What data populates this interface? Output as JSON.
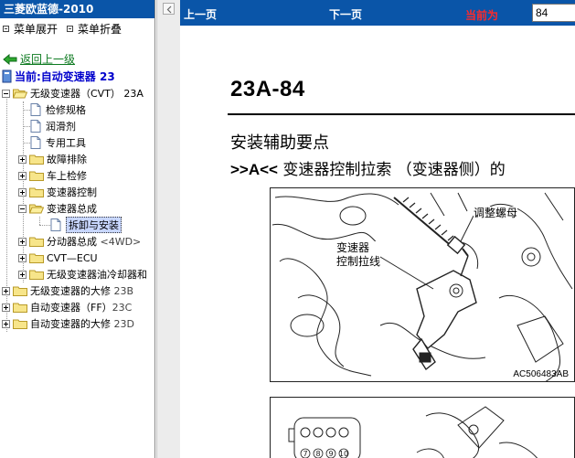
{
  "app": {
    "title": "三菱欧蓝德-2010"
  },
  "menu": {
    "expand": "菜单展开",
    "collapse": "菜单折叠"
  },
  "back": {
    "label": "返回上一级"
  },
  "current": {
    "label": "当前:自动变速器  23"
  },
  "tree": [
    {
      "label": "无级变速器（CVT） 23A",
      "sub": ""
    },
    {
      "label": "检修规格",
      "sub": ""
    },
    {
      "label": "润滑剂",
      "sub": ""
    },
    {
      "label": "专用工具",
      "sub": ""
    },
    {
      "label": "故障排除",
      "sub": ""
    },
    {
      "label": "车上检修",
      "sub": ""
    },
    {
      "label": "变速器控制",
      "sub": ""
    },
    {
      "label": "变速器总成",
      "sub": ""
    },
    {
      "label": "拆卸与安装",
      "sub": ""
    },
    {
      "label": "分动器总成",
      "sub": " <4WD>"
    },
    {
      "label": "CVT—ECU",
      "sub": ""
    },
    {
      "label": "无级变速器油冷却器和",
      "sub": ""
    },
    {
      "label": "无级变速器的大修",
      "sub": " 23B"
    },
    {
      "label": "自动变速器（FF）",
      "sub": "23C"
    },
    {
      "label": "自动变速器的大修",
      "sub": " 23D"
    }
  ],
  "nav": {
    "prev": "上一页",
    "next": "下一页",
    "current_label": "当前为",
    "page_value": "84"
  },
  "doc": {
    "page_number": "23A-84",
    "heading": "安装辅助要点",
    "subheading_marker": ">>A<<",
    "subheading_text": " 变速器控制拉索 （变速器侧）的",
    "figure": {
      "callout_nut": "调整螺母",
      "callout_cable_line1": "变速器",
      "callout_cable_line2": "控制拉线",
      "code": "AC506483AB"
    },
    "figure2": {
      "connector_pins_row2": [
        "7",
        "8",
        "9",
        "10"
      ]
    }
  },
  "colors": {
    "title_bar": "#0a55a8",
    "current_label": "#ff2a2a",
    "current_node": "#0000cc",
    "back_link": "#0d7a20"
  }
}
